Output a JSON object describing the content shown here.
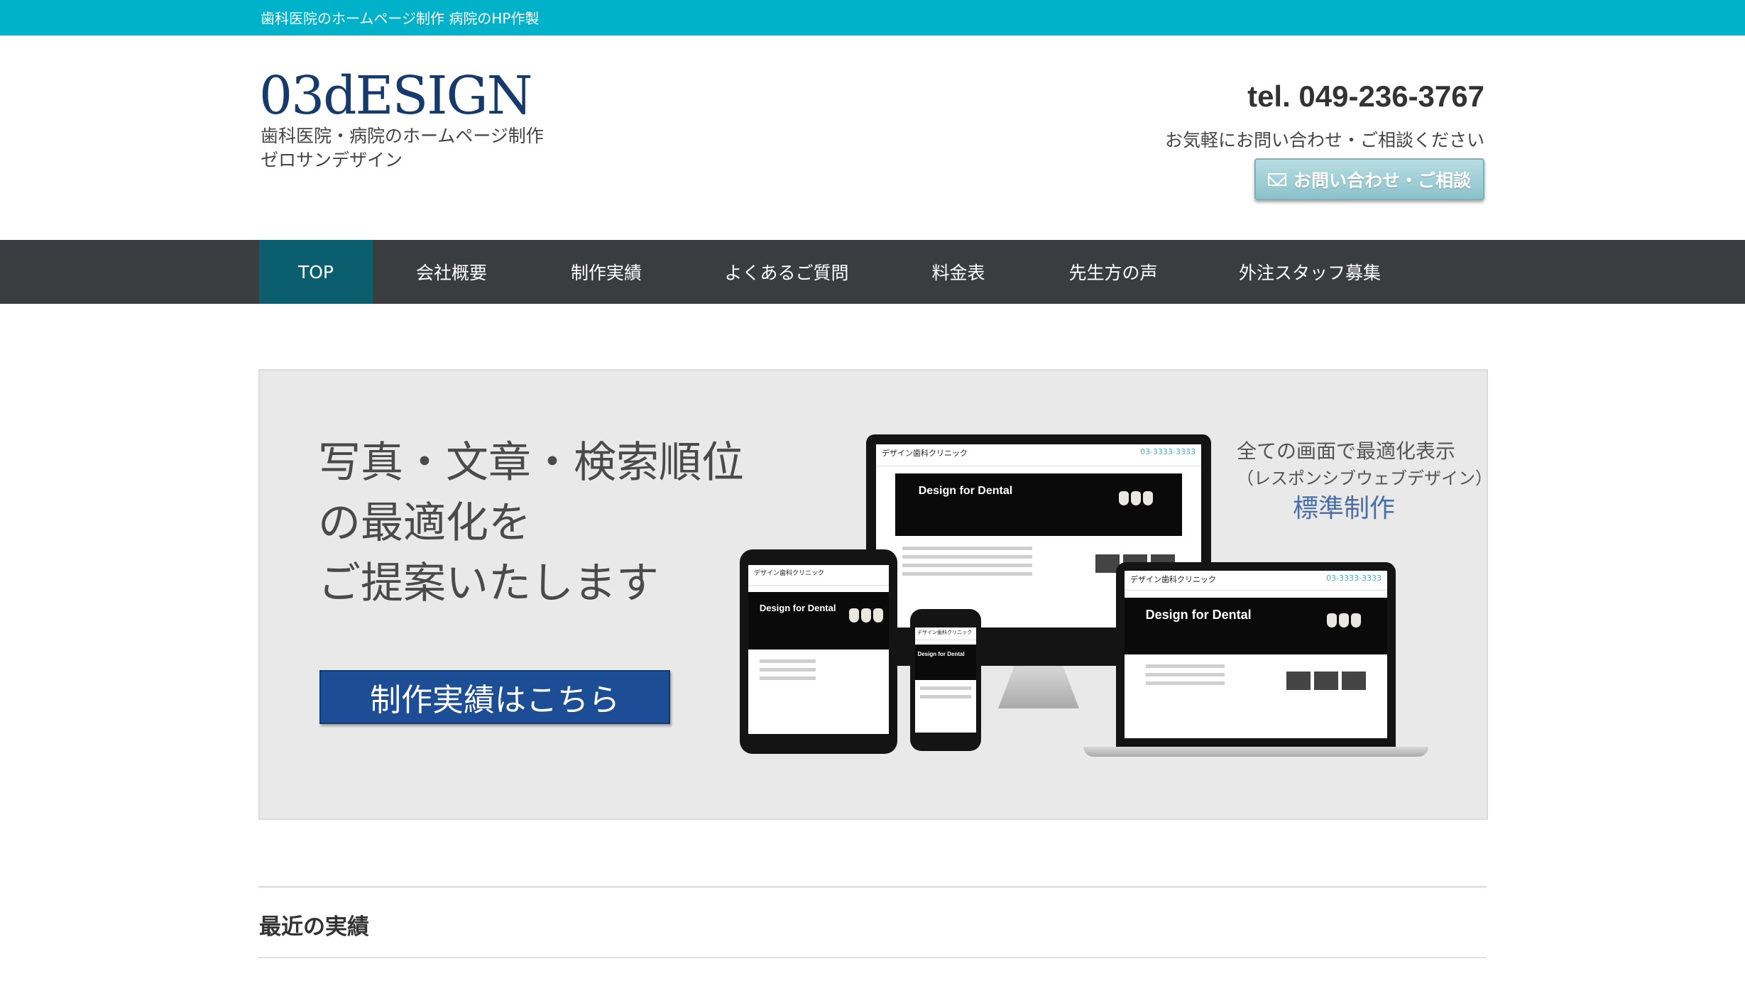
{
  "topbar": {
    "text": "歯科医院のホームページ制作 病院のHP作製"
  },
  "header": {
    "logo": "03dESIGN",
    "tagline_line1": "歯科医院・病院のホームページ制作",
    "tagline_line2": "ゼロサンデザイン",
    "tel": "tel. 049-236-3767",
    "tel_note": "お気軽にお問い合わせ・ご相談ください",
    "contact_button": "お問い合わせ・ご相談"
  },
  "nav": {
    "items": [
      {
        "label": "TOP",
        "active": true
      },
      {
        "label": "会社概要"
      },
      {
        "label": "制作実績"
      },
      {
        "label": "よくあるご質問"
      },
      {
        "label": "料金表"
      },
      {
        "label": "先生方の声"
      },
      {
        "label": "外注スタッフ募集"
      }
    ]
  },
  "hero": {
    "line1": "写真・文章・検索順位",
    "line2": "の最適化を",
    "line3": "ご提案いたします",
    "button": "制作実績はこちら",
    "side_line1": "全ての画面で最適化表示",
    "side_line2": "（レスポンシブウェブデザイン）",
    "side_line3": "標準制作",
    "mock_site_name": "デザイン歯科クリニック",
    "mock_phone": "03-3333-3333",
    "mock_headline": "Design for Dental"
  },
  "section": {
    "title": "最近の実績"
  },
  "colors": {
    "topbar": "#00b2c9",
    "nav": "#3a3d3f",
    "nav_active": "#0b5e6e",
    "hero_button": "#1c4d95",
    "logo": "#163a6b"
  }
}
